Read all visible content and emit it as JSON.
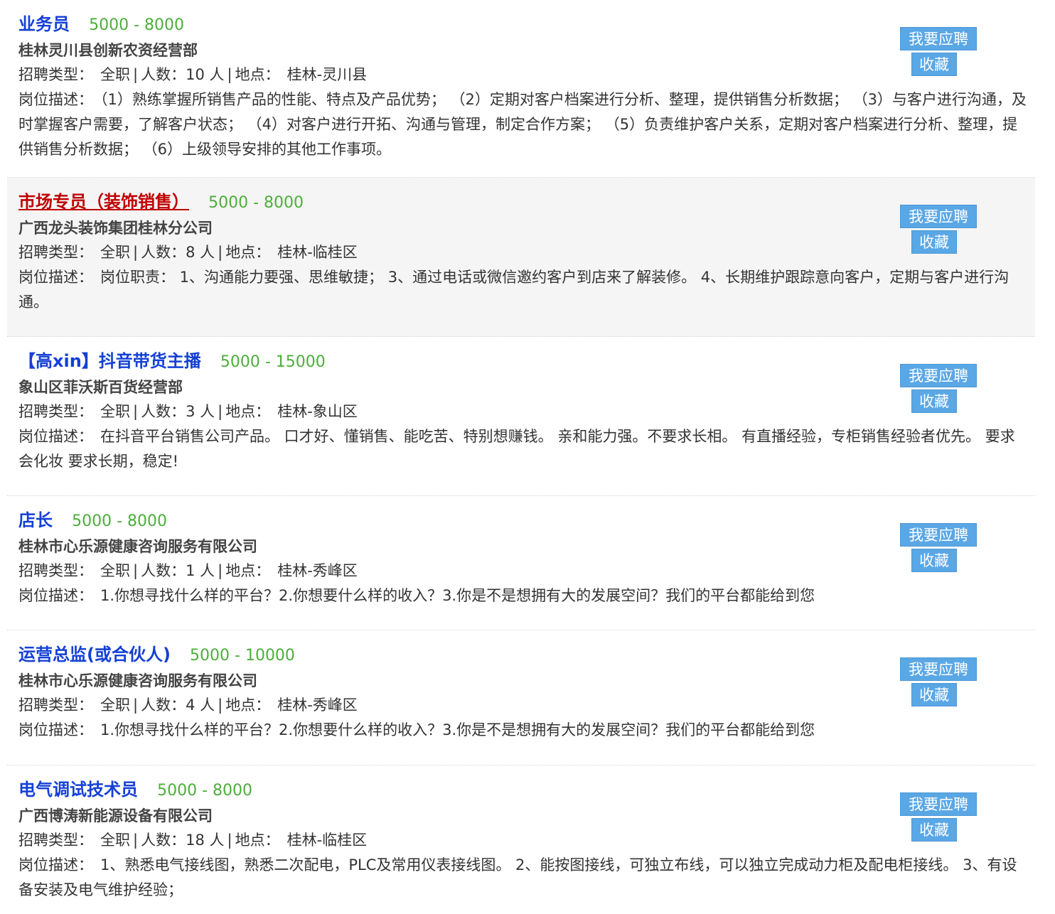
{
  "labels": {
    "type": "招聘类型：",
    "count_prefix": "人数：",
    "count_suffix": "人",
    "location": "地点：",
    "desc": "岗位描述：",
    "apply": "我要应聘",
    "favorite": "收藏"
  },
  "jobs": [
    {
      "title": "业务员",
      "salary": "5000 - 8000",
      "company": "桂林灵川县创新农资经营部",
      "type": "全职",
      "count": "10",
      "location": "桂林-灵川县",
      "desc": "（1）熟练掌握所销售产品的性能、特点及产品优势；  （2）定期对客户档案进行分析、整理，提供销售分析数据；  （3）与客户进行沟通，及时掌握客户需要，了解客户状态；  （4）对客户进行开拓、沟通与管理，制定合作方案；  （5）负责维护客户关系，定期对客户档案进行分析、整理，提供销售分析数据；  （6）上级领导安排的其他工作事项。"
    },
    {
      "title": "市场专员（装饰销售）",
      "salary": "5000 - 8000",
      "company": "广西龙头装饰集团桂林分公司",
      "type": "全职",
      "count": "8",
      "location": "桂林-临桂区",
      "desc": "岗位职责： 1、沟通能力要强、思维敏捷； 3、通过电话或微信邀约客户到店来了解装修。 4、长期维护跟踪意向客户，定期与客户进行沟通。"
    },
    {
      "title": "【高xin】抖音带货主播",
      "salary": "5000 - 15000",
      "company": "象山区菲沃斯百货经营部",
      "type": "全职",
      "count": "3",
      "location": "桂林-象山区",
      "desc": "在抖音平台销售公司产品。 口才好、懂销售、能吃苦、特别想赚钱。 亲和能力强。不要求长相。 有直播经验，专柜销售经验者优先。 要求会化妆 要求长期，稳定!"
    },
    {
      "title": "店长",
      "salary": "5000 - 8000",
      "company": "桂林市心乐源健康咨询服务有限公司",
      "type": "全职",
      "count": "1",
      "location": "桂林-秀峰区",
      "desc": "1.你想寻找什么样的平台？2.你想要什么样的收入？3.你是不是想拥有大的发展空间？我们的平台都能给到您"
    },
    {
      "title": "运营总监(或合伙人)",
      "salary": "5000 - 10000",
      "company": "桂林市心乐源健康咨询服务有限公司",
      "type": "全职",
      "count": "4",
      "location": "桂林-秀峰区",
      "desc": "1.你想寻找什么样的平台？2.你想要什么样的收入？3.你是不是想拥有大的发展空间？我们的平台都能给到您"
    },
    {
      "title": "电气调试技术员",
      "salary": "5000 - 8000",
      "company": "广西博涛新能源设备有限公司",
      "type": "全职",
      "count": "18",
      "location": "桂林-临桂区",
      "desc": "1、熟悉电气接线图，熟悉二次配电，PLC及常用仪表接线图。 2、能按图接线，可独立布线，可以独立完成动力柜及配电柜接线。 3、有设备安装及电气维护经验；"
    }
  ]
}
